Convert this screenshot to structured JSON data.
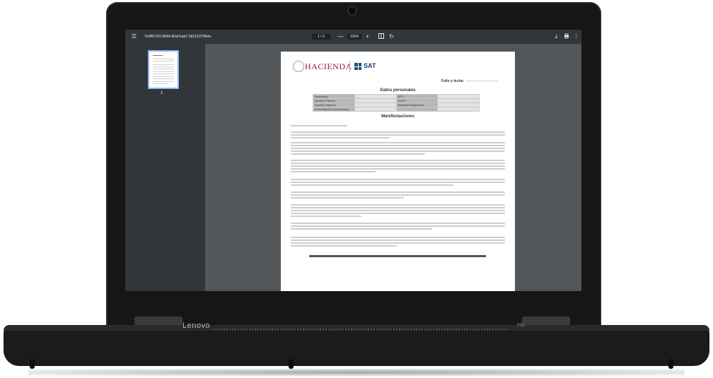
{
  "viewer": {
    "menu_icon": "menu-icon",
    "file_name": "7m8f97SH-984A-80af-bab7-0d1101f78b4a",
    "page_current": "1",
    "page_sep": "/",
    "page_total": "2",
    "zoom_out": "—",
    "zoom_level": "100%",
    "zoom_in": "+",
    "fit_icon": "fit-page-icon",
    "rotate_icon": "rotate-icon",
    "download_icon": "download-icon",
    "print_icon": "print-icon",
    "more_icon": "more-vertical-icon",
    "thumbnail_page": "1"
  },
  "document": {
    "logo_hacienda": "HACIENDA",
    "logo_sat": "SAT",
    "folio_label": "Folio y fecha:",
    "section_datos": "Datos personales",
    "datos_rows": [
      [
        "Nombre(s)",
        "",
        "RFC",
        ""
      ],
      [
        "Apellido Paterno",
        "",
        "CURP",
        ""
      ],
      [
        "Apellido Materno",
        "",
        "Régimen/Regímenes",
        ""
      ],
      [
        "Actividad(es) Económica(s)",
        "",
        "",
        ""
      ]
    ],
    "section_manif": "Manifestaciones"
  },
  "device": {
    "brand": "Lenovo",
    "model": "P50"
  }
}
